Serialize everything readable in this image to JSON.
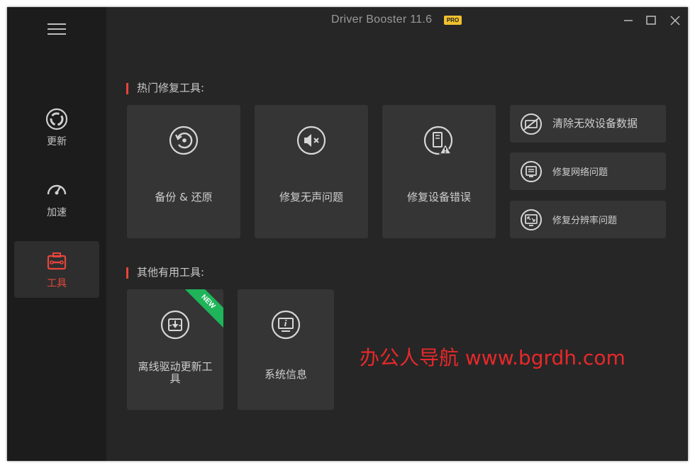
{
  "window": {
    "title": "Driver Booster 11.6",
    "badge": "PRO"
  },
  "sidebar": {
    "items": [
      {
        "label": "更新",
        "icon": "refresh-icon"
      },
      {
        "label": "加速",
        "icon": "speedometer-icon"
      },
      {
        "label": "工具",
        "icon": "toolbox-icon",
        "active": true
      }
    ]
  },
  "sections": {
    "hot": "热门修复工具:",
    "other": "其他有用工具:"
  },
  "hot_tools": [
    {
      "label": "备份 & 还原",
      "icon": "backup-restore-icon"
    },
    {
      "label": "修复无声问题",
      "icon": "mute-speaker-icon"
    },
    {
      "label": "修复设备错误",
      "icon": "device-error-icon"
    }
  ],
  "side_tools": [
    {
      "label": "清除无效设备数据",
      "icon": "clean-device-data-icon"
    },
    {
      "label": "修复网络问题",
      "icon": "network-icon"
    },
    {
      "label": "修复分辨率问题",
      "icon": "resolution-icon"
    }
  ],
  "other_tools": [
    {
      "label": "离线驱动更新工具",
      "icon": "offline-download-icon",
      "badge": "NEW"
    },
    {
      "label": "系统信息",
      "icon": "system-info-icon"
    }
  ],
  "watermark": "办公人导航  www.bgrdh.com",
  "colors": {
    "accent": "#e8453c",
    "badge": "#f0c030",
    "new_ribbon": "#1fb45a",
    "card": "#353535"
  }
}
